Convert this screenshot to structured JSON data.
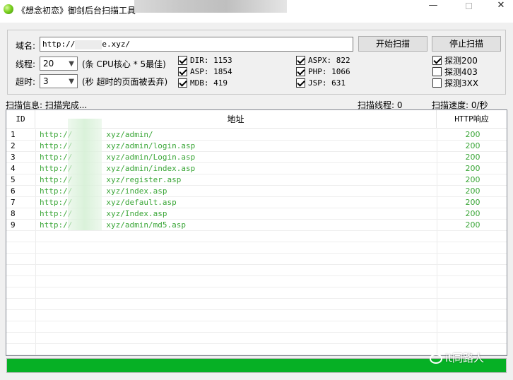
{
  "window": {
    "title": "《想念初恋》御剑后台扫描工具",
    "min_glyph": "—",
    "close_glyph": "✕"
  },
  "form": {
    "domain_label": "域名:",
    "domain_prefix": "http://",
    "domain_suffix": "e.xyz/",
    "threads_label": "线程:",
    "threads_value": "20",
    "threads_note": "(条 CPU核心 * 5最佳)",
    "timeout_label": "超时:",
    "timeout_value": "3",
    "timeout_note": "(秒 超时的页面被丢弃)",
    "start_button": "开始扫描",
    "stop_button": "停止扫描"
  },
  "dicts": [
    {
      "label": "DIR: 1153",
      "checked": true
    },
    {
      "label": "ASP: 1854",
      "checked": true
    },
    {
      "label": "MDB: 419",
      "checked": true
    },
    {
      "label": "ASPX: 822",
      "checked": true
    },
    {
      "label": "PHP: 1066",
      "checked": true
    },
    {
      "label": "JSP: 631",
      "checked": true
    }
  ],
  "probes": [
    {
      "label": "探测200",
      "checked": true
    },
    {
      "label": "探测403",
      "checked": false
    },
    {
      "label": "探测3XX",
      "checked": false
    }
  ],
  "status": {
    "info": "扫描信息: 扫描完成...",
    "threads": "扫描线程: 0",
    "speed": "扫描速度: 0/秒"
  },
  "table": {
    "headers": {
      "id": "ID",
      "url": "地址",
      "http": "HTTP响应"
    },
    "rows": [
      {
        "id": "1",
        "url_prefix": "http://",
        "url_suffix": "xyz/admin/",
        "http": "200"
      },
      {
        "id": "2",
        "url_prefix": "http://",
        "url_suffix": "xyz/admin/login.asp",
        "http": "200"
      },
      {
        "id": "3",
        "url_prefix": "http://",
        "url_suffix": "xyz/admin/Login.asp",
        "http": "200"
      },
      {
        "id": "4",
        "url_prefix": "http://",
        "url_suffix": "xyz/admin/index.asp",
        "http": "200"
      },
      {
        "id": "5",
        "url_prefix": "http://",
        "url_suffix": "xyz/register.asp",
        "http": "200"
      },
      {
        "id": "6",
        "url_prefix": "http://",
        "url_suffix": "xyz/index.asp",
        "http": "200"
      },
      {
        "id": "7",
        "url_prefix": "http://",
        "url_suffix": "xyz/default.asp",
        "http": "200"
      },
      {
        "id": "8",
        "url_prefix": "http://",
        "url_suffix": "xyz/Index.asp",
        "http": "200"
      },
      {
        "id": "9",
        "url_prefix": "http://",
        "url_suffix": "xyz/admin/md5.asp",
        "http": "200"
      }
    ]
  },
  "progress": {
    "fraction": 1.0
  },
  "watermark": "it同路人",
  "colors": {
    "progress_green": "#06b025",
    "url_green": "#3aa637"
  }
}
